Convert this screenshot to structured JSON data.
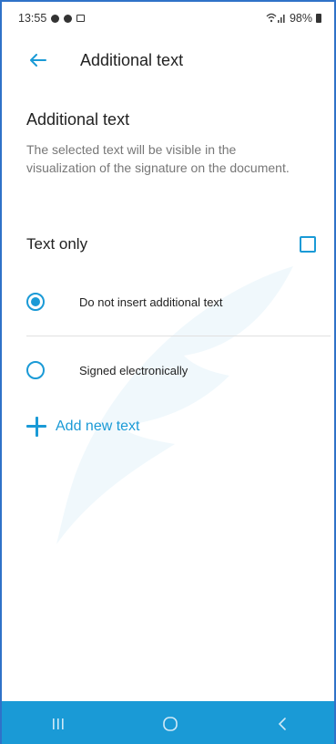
{
  "status_bar": {
    "time": "13:55",
    "battery": "98%"
  },
  "app_bar": {
    "title": "Additional text",
    "back_icon": "arrow-left-icon"
  },
  "section": {
    "title": "Additional text",
    "description": "The selected text will be visible in the visualization of the signature on the document."
  },
  "text_only": {
    "label": "Text only",
    "checked": false
  },
  "options": [
    {
      "label": "Do not insert additional text",
      "selected": true
    },
    {
      "label": "Signed electronically",
      "selected": false
    }
  ],
  "add_new": {
    "label": "Add new text",
    "icon": "plus-icon"
  },
  "nav_bar": {
    "recent_icon": "recent-apps-icon",
    "home_icon": "home-icon",
    "back_icon": "back-icon"
  },
  "colors": {
    "accent": "#1a9ad6",
    "frame_border": "#2f72c8"
  }
}
